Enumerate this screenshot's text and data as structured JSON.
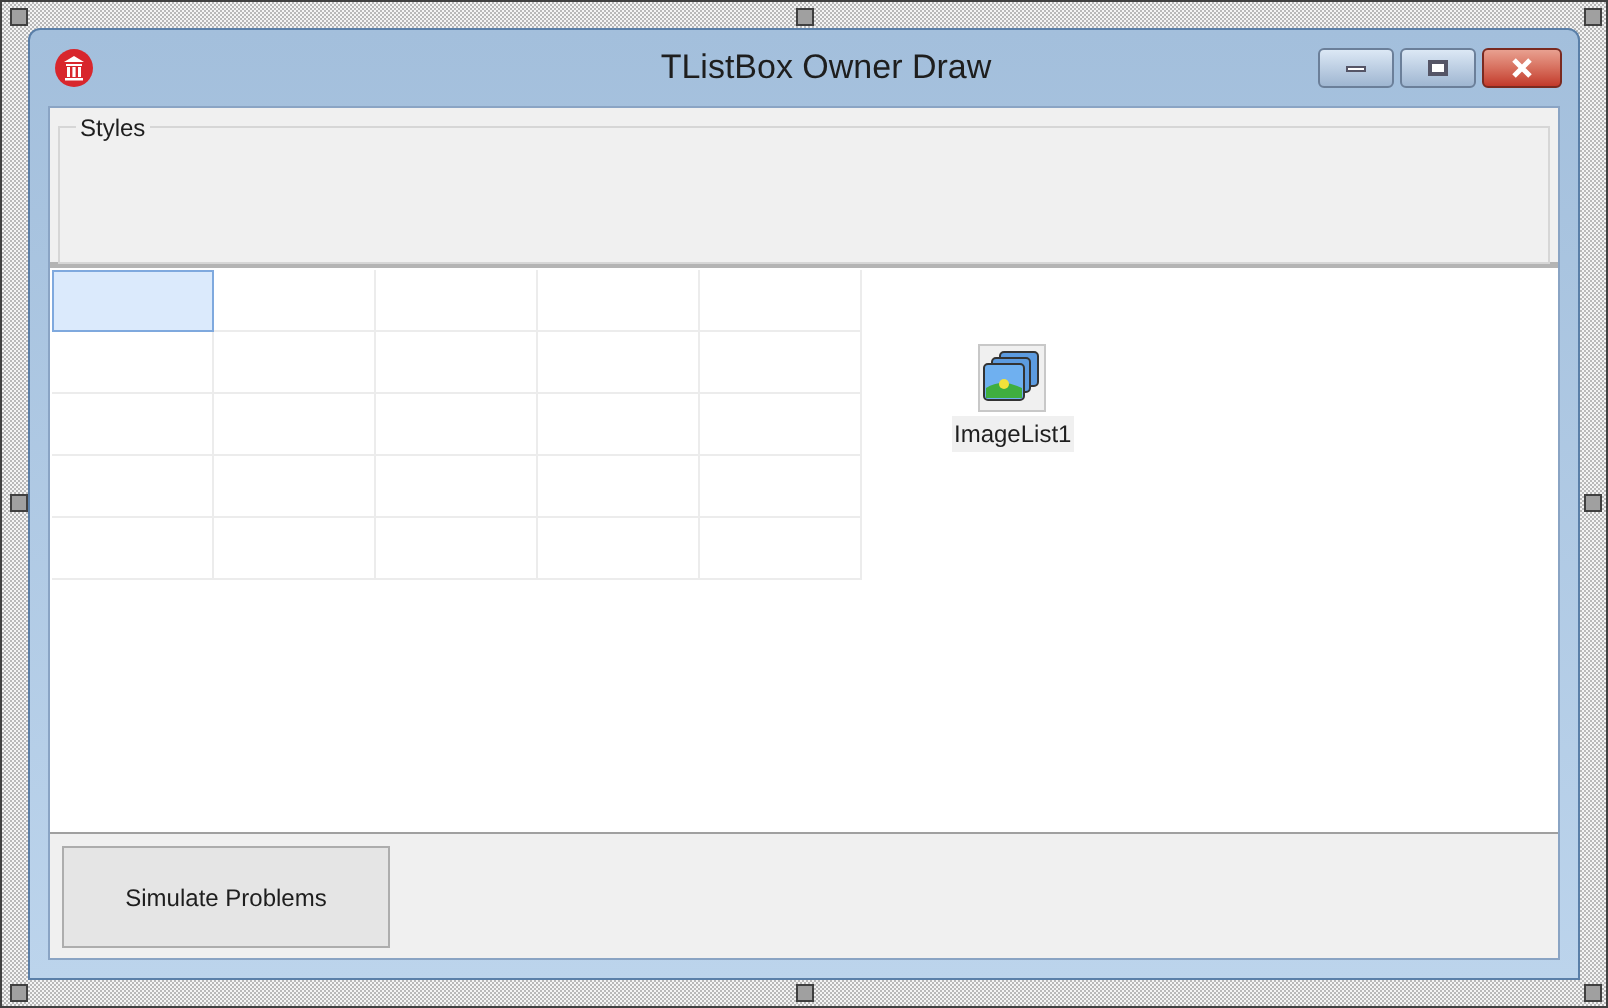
{
  "window": {
    "title": "TListBox Owner Draw"
  },
  "styles_group": {
    "label": "Styles"
  },
  "grid": {
    "rows": [
      {
        "cells": [
          {
            "selected": true
          },
          {
            "selected": false
          },
          {
            "selected": false
          },
          {
            "selected": false
          },
          {
            "selected": false
          }
        ]
      },
      {
        "cells": [
          {
            "selected": false
          },
          {
            "selected": false
          },
          {
            "selected": false
          },
          {
            "selected": false
          },
          {
            "selected": false
          }
        ]
      },
      {
        "cells": [
          {
            "selected": false
          },
          {
            "selected": false
          },
          {
            "selected": false
          },
          {
            "selected": false
          },
          {
            "selected": false
          }
        ]
      },
      {
        "cells": [
          {
            "selected": false
          },
          {
            "selected": false
          },
          {
            "selected": false
          },
          {
            "selected": false
          },
          {
            "selected": false
          }
        ]
      },
      {
        "cells": [
          {
            "selected": false
          },
          {
            "selected": false
          },
          {
            "selected": false
          },
          {
            "selected": false
          },
          {
            "selected": false
          }
        ]
      }
    ]
  },
  "component": {
    "label": "ImageList1"
  },
  "buttons": [
    "Simulate Problems"
  ]
}
